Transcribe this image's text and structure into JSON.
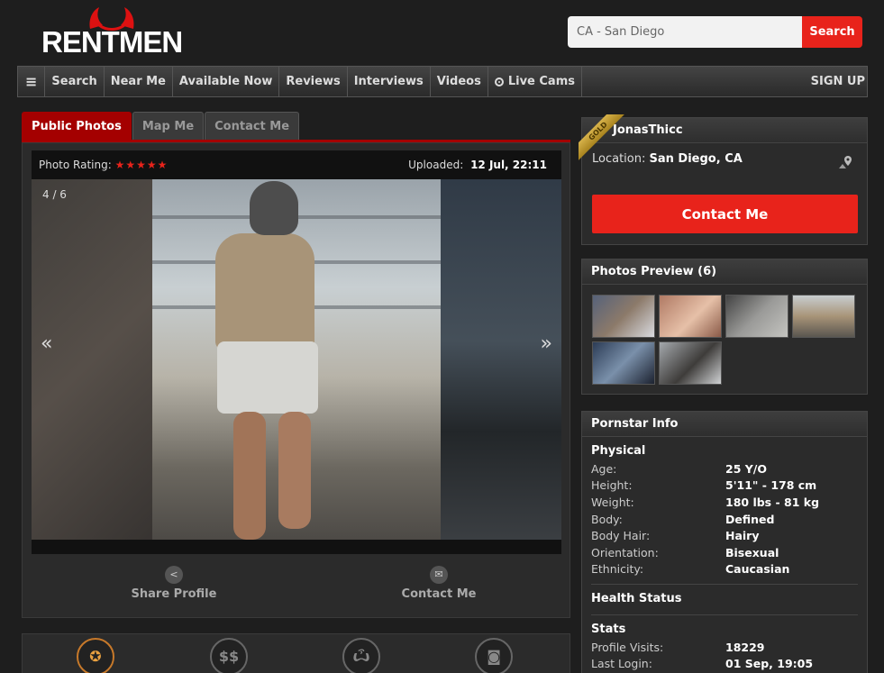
{
  "header": {
    "logo_text": "RENTMEN",
    "search_value": "CA - San Diego",
    "search_button": "Search"
  },
  "nav": {
    "menu_icon": "≡",
    "items": [
      "Search",
      "Near Me",
      "Available Now",
      "Reviews",
      "Interviews",
      "Videos",
      "Live Cams"
    ],
    "signup": "SIGN UP"
  },
  "tabs": [
    "Public Photos",
    "Map Me",
    "Contact Me"
  ],
  "viewer": {
    "rating_label": "Photo Rating:",
    "stars": "★★★★★",
    "uploaded_label": "Uploaded:",
    "uploaded_value": "12 Jul, 22:11",
    "counter": "4 / 6",
    "prev": "«",
    "next": "»"
  },
  "actions": {
    "share": "Share Profile",
    "contact": "Contact Me"
  },
  "profile": {
    "badge": "GOLD",
    "name": "JonasThicc",
    "location_label": "Location:",
    "location_value": "San Diego, CA",
    "contact_button": "Contact Me"
  },
  "photos_preview": {
    "title": "Photos Preview (6)"
  },
  "pornstar_info": {
    "title": "Pornstar Info",
    "physical_title": "Physical",
    "physical": [
      {
        "k": "Age:",
        "v": "25 Y/O"
      },
      {
        "k": "Height:",
        "v": "5'11\" - 178 cm"
      },
      {
        "k": "Weight:",
        "v": "180 lbs - 81 kg"
      },
      {
        "k": "Body:",
        "v": "Defined"
      },
      {
        "k": "Body Hair:",
        "v": "Hairy"
      },
      {
        "k": "Orientation:",
        "v": "Bisexual"
      },
      {
        "k": "Ethnicity:",
        "v": "Caucasian"
      }
    ],
    "health_title": "Health Status",
    "stats_title": "Stats",
    "stats": [
      {
        "k": "Profile Visits:",
        "v": "18229"
      },
      {
        "k": "Last Login:",
        "v": "01 Sep, 19:05"
      }
    ]
  },
  "colors": {
    "accent": "#e8231b",
    "tab_active": "#a40000",
    "gold": "#c79b2c"
  }
}
